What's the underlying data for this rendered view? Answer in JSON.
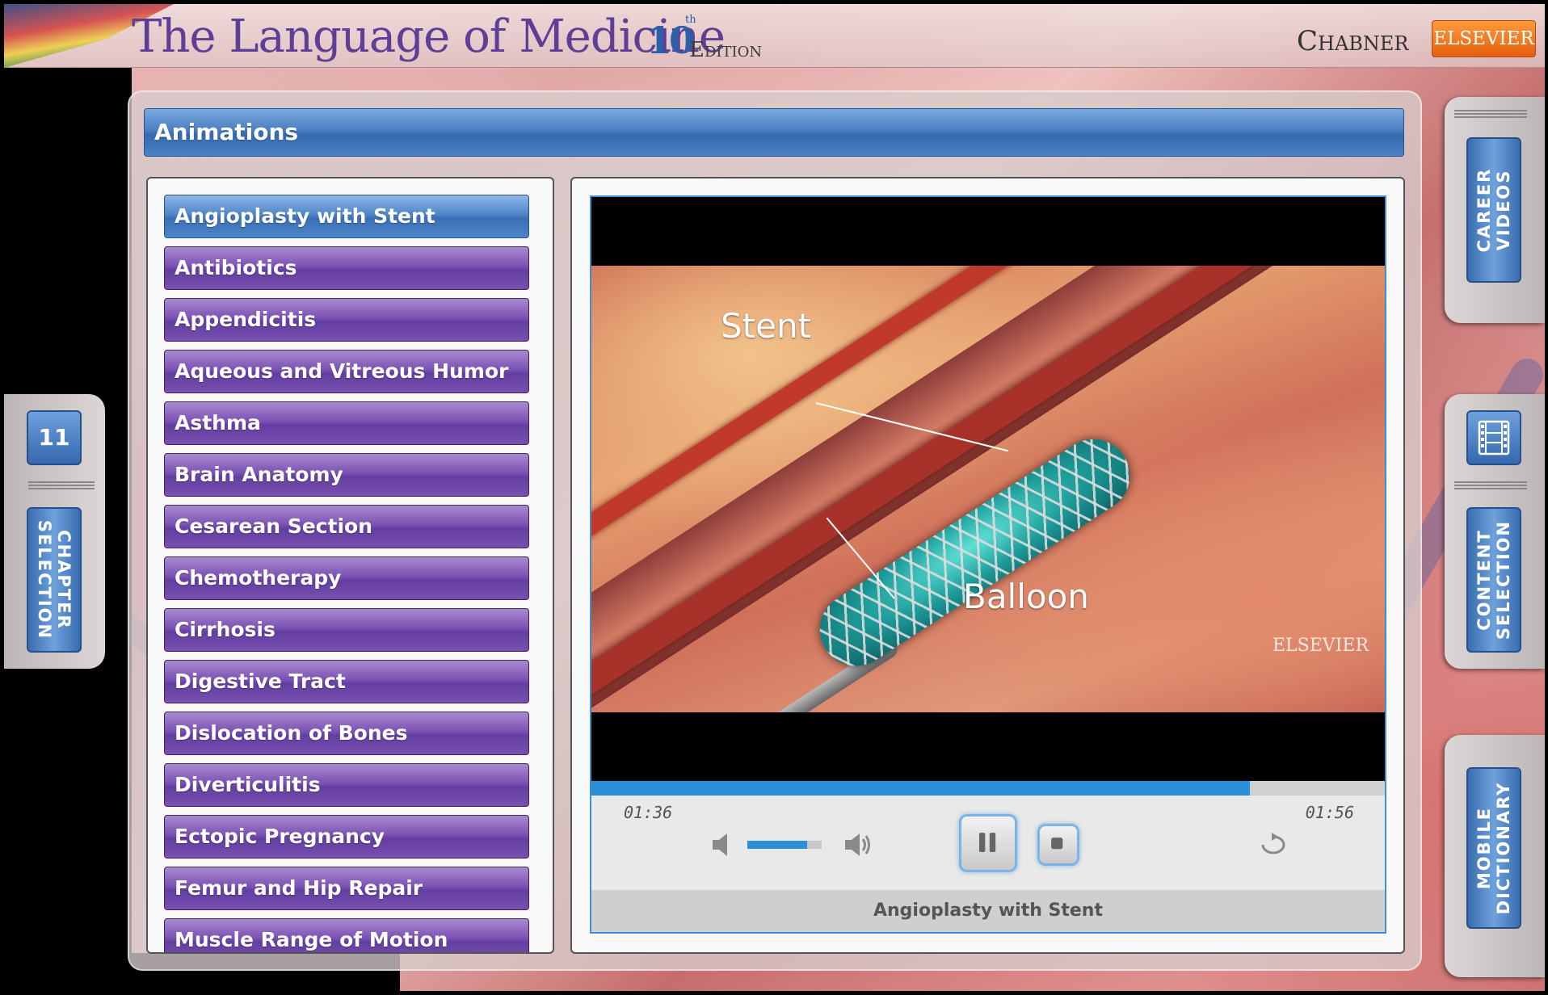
{
  "header": {
    "app_title": "The Language of Medicine",
    "edition_number": "10",
    "edition_suffix": "th",
    "edition_label": "Edition",
    "author": "Chabner",
    "publisher": "ELSEVIER"
  },
  "panel": {
    "title": "Animations"
  },
  "animations": {
    "selected_index": 0,
    "items": [
      "Angioplasty with Stent",
      "Antibiotics",
      "Appendicitis",
      "Aqueous and Vitreous Humor",
      "Asthma",
      "Brain Anatomy",
      "Cesarean Section",
      "Chemotherapy",
      "Cirrhosis",
      "Digestive Tract",
      "Dislocation of Bones",
      "Diverticulitis",
      "Ectopic Pregnancy",
      "Femur and Hip Repair",
      "Muscle Range of Motion"
    ]
  },
  "player": {
    "video_labels": {
      "stent": "Stent",
      "balloon": "Balloon",
      "watermark": "ELSEVIER"
    },
    "time_elapsed": "01:36",
    "time_total": "01:56",
    "progress_fraction": 0.83,
    "volume_fraction": 0.8,
    "state": "playing",
    "caption": "Angioplasty with Stent"
  },
  "sidebar_left": {
    "chapter_number": "11",
    "chapter_selection_label": "CHAPTER SELECTION"
  },
  "sidebar_right": {
    "career_videos_label": "CAREER VIDEOS",
    "content_selection_label": "CONTENT SELECTION",
    "mobile_dictionary_label": "MOBILE DICTIONARY",
    "film_icon": "film-icon"
  },
  "colors": {
    "accent_blue": "#3f8fd4",
    "list_purple": "#6b44a8",
    "publisher_orange": "#e8711a",
    "title_purple": "#5e3f96"
  }
}
